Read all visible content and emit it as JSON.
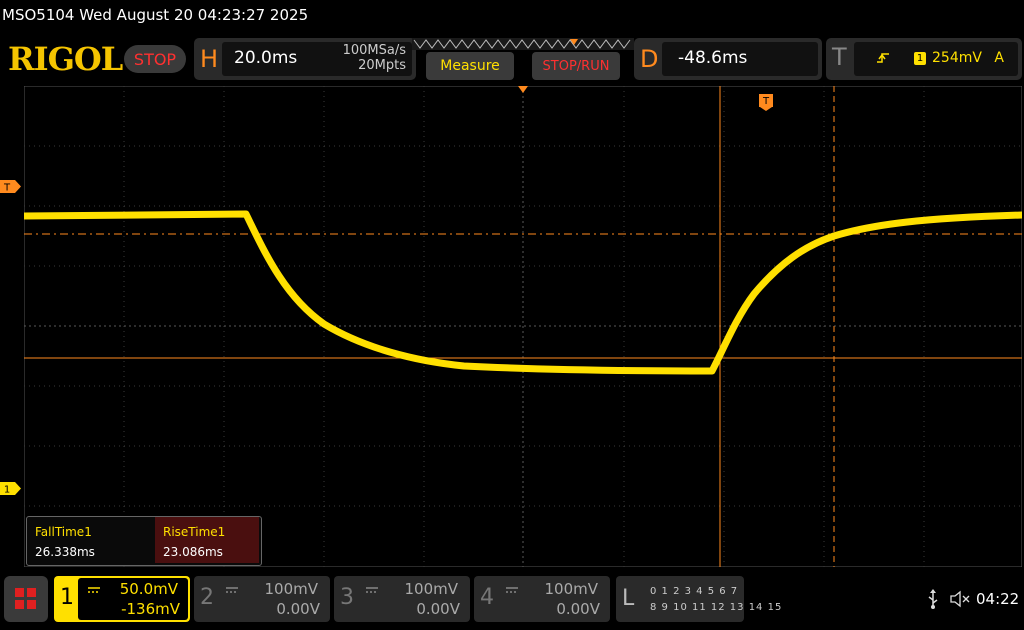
{
  "window": {
    "title": "MSO5104  Wed August 20 04:23:27 2025"
  },
  "brand": {
    "logo": "RIGOL",
    "status": "STOP"
  },
  "horizontal": {
    "letter": "H",
    "timebase": "20.0ms",
    "sample_rate": "100MSa/s",
    "memory_depth": "20Mpts"
  },
  "buttons": {
    "measure": "Measure",
    "stop_run": "STOP/RUN"
  },
  "delay": {
    "letter": "D",
    "value": "-48.6ms"
  },
  "trigger": {
    "letter": "T",
    "source": "1",
    "level": "254mV",
    "mode": "A",
    "edge_icon": "rising-edge-icon"
  },
  "markers": {
    "trigger": "T",
    "channel1": "1"
  },
  "measurements": [
    {
      "name": "FallTime1",
      "value": "26.338ms"
    },
    {
      "name": "RiseTime1",
      "value": "23.086ms"
    }
  ],
  "channels": [
    {
      "num": "1",
      "scale": "50.0mV",
      "offset": "-136mV",
      "active": true,
      "color": "#ffe000"
    },
    {
      "num": "2",
      "scale": "100mV",
      "offset": "0.00V",
      "active": false,
      "color": "#888888"
    },
    {
      "num": "3",
      "scale": "100mV",
      "offset": "0.00V",
      "active": false,
      "color": "#888888"
    },
    {
      "num": "4",
      "scale": "100mV",
      "offset": "0.00V",
      "active": false,
      "color": "#888888"
    }
  ],
  "logic": {
    "letter": "L",
    "row1": "0 1 2 3  4 5 6 7",
    "row2": "8 9 10 11 12 13 14 15"
  },
  "status_bar": {
    "clock": "04:22"
  },
  "colors": {
    "trace": "#ffe000",
    "accent": "#ff8a1e",
    "stop": "#ff3030"
  }
}
